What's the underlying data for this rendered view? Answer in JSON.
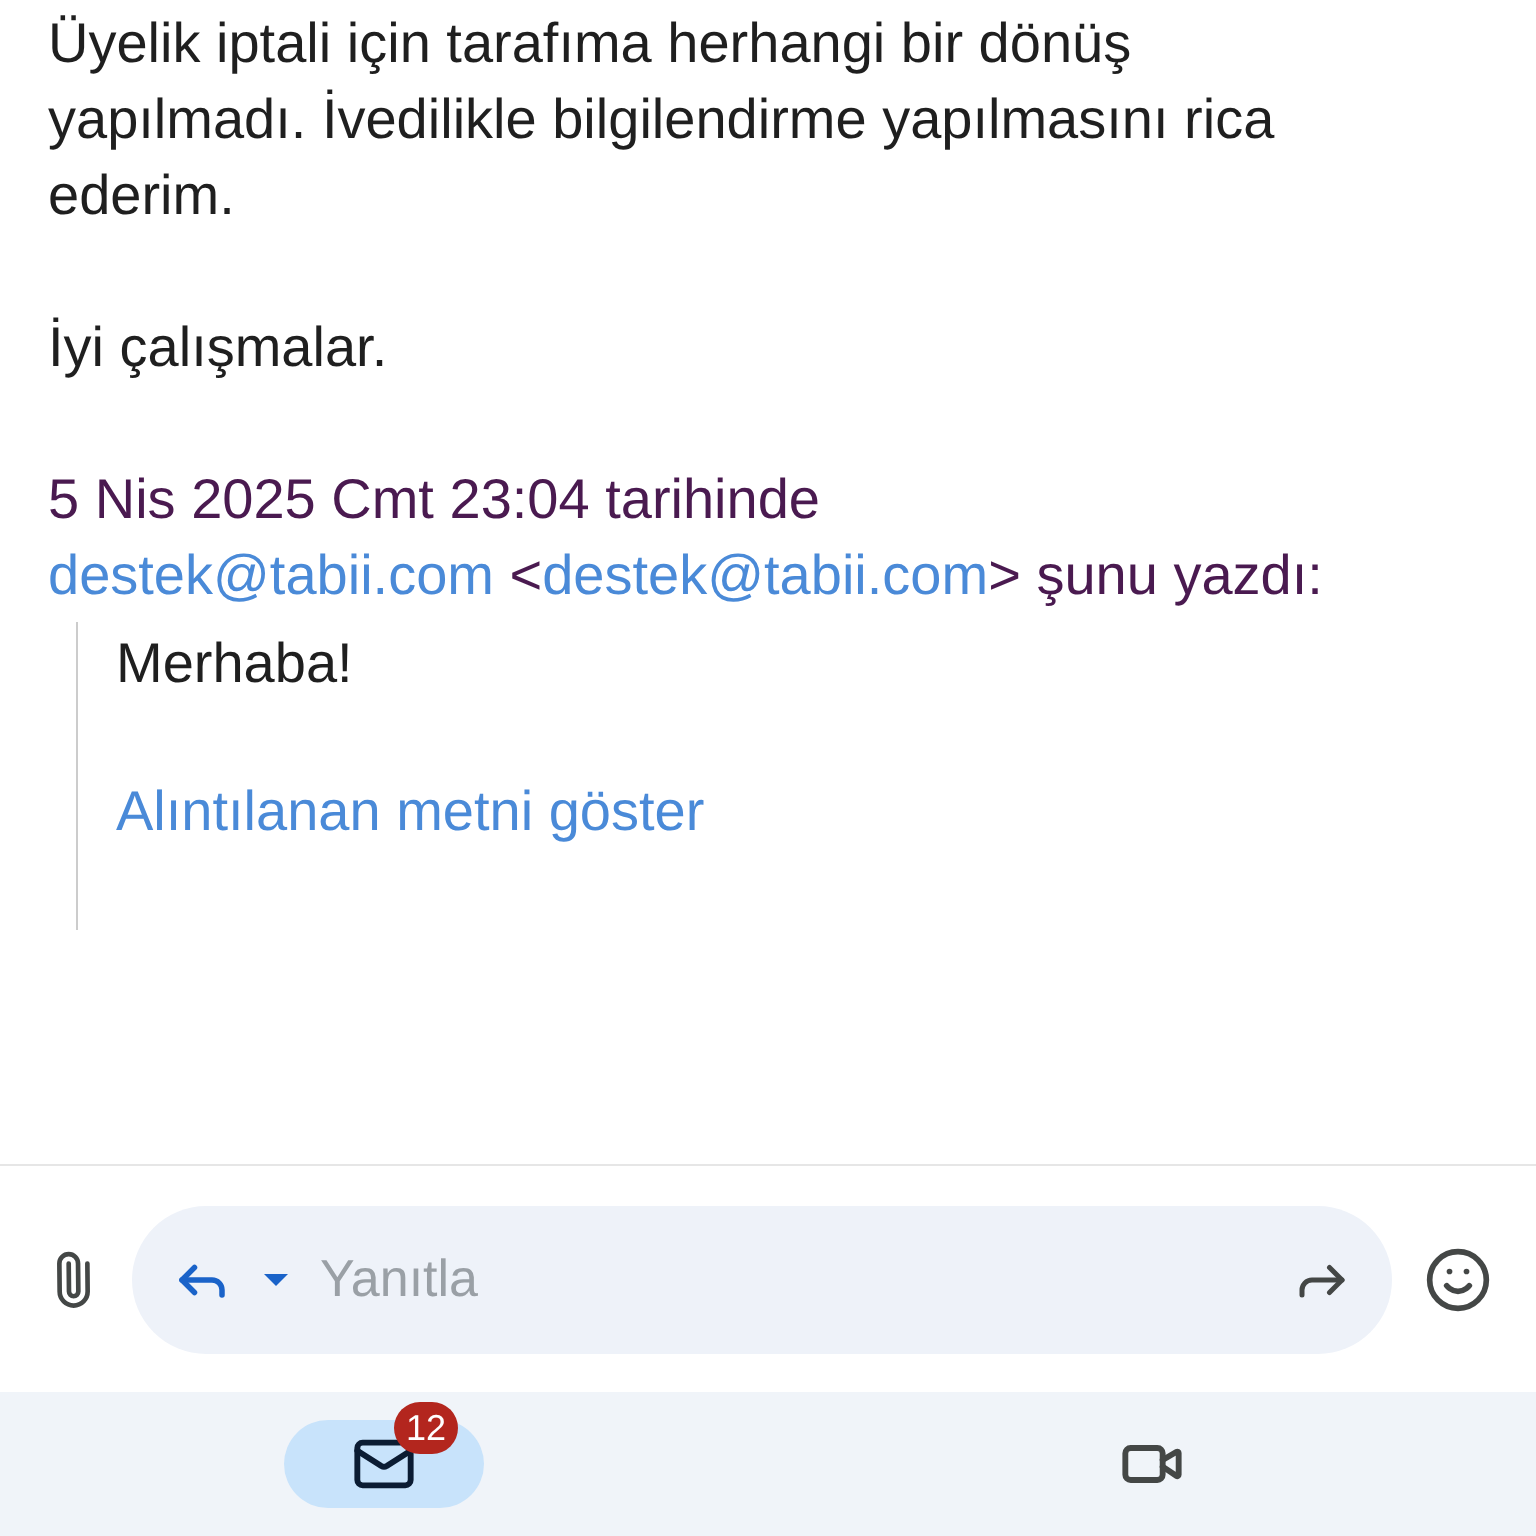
{
  "message": {
    "paragraphs": [
      "Üyelik iptali için tarafıma herhangi bir dönüş yapılmadı. İvedilikle bilgilendirme yapılmasını rica ederim.",
      "İyi çalışmalar."
    ],
    "attribution": {
      "date_text": "5 Nis 2025 Cmt 23:04 tarihinde",
      "sender_name": "destek@tabii.com",
      "email_open": "<",
      "sender_email": "destek@tabii.com",
      "email_close": ">",
      "suffix": "şunu yazdı:"
    },
    "quote": {
      "text": "Merhaba!",
      "show_quoted_link": "Alıntılanan metni göster"
    }
  },
  "reply_bar": {
    "placeholder": "Yanıtla"
  },
  "bottom_nav": [
    {
      "kind": "mail",
      "selected": true,
      "badge": "12"
    },
    {
      "kind": "video",
      "selected": false
    }
  ]
}
